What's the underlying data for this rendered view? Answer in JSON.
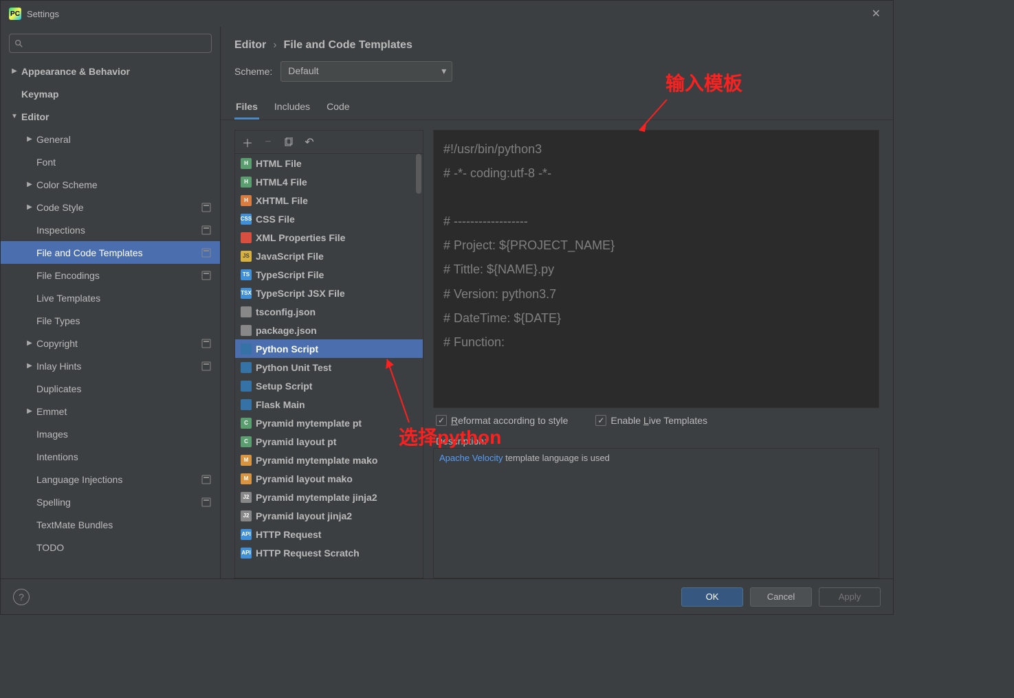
{
  "window": {
    "title": "Settings"
  },
  "sidebar": {
    "search_placeholder": "",
    "items": [
      {
        "label": "Appearance & Behavior",
        "expand": "right",
        "lv": 0
      },
      {
        "label": "Keymap",
        "lv": 0
      },
      {
        "label": "Editor",
        "expand": "down",
        "lv": 0
      },
      {
        "label": "General",
        "expand": "right",
        "lv": 1,
        "sub": true
      },
      {
        "label": "Font",
        "lv": 1,
        "sub": true
      },
      {
        "label": "Color Scheme",
        "expand": "right",
        "lv": 1,
        "sub": true
      },
      {
        "label": "Code Style",
        "expand": "right",
        "lv": 1,
        "sub": true,
        "badge": true
      },
      {
        "label": "Inspections",
        "lv": 1,
        "sub": true,
        "badge": true
      },
      {
        "label": "File and Code Templates",
        "lv": 1,
        "sub": true,
        "badge": true,
        "selected": true
      },
      {
        "label": "File Encodings",
        "lv": 1,
        "sub": true,
        "badge": true
      },
      {
        "label": "Live Templates",
        "lv": 1,
        "sub": true
      },
      {
        "label": "File Types",
        "lv": 1,
        "sub": true
      },
      {
        "label": "Copyright",
        "expand": "right",
        "lv": 1,
        "sub": true,
        "badge": true
      },
      {
        "label": "Inlay Hints",
        "expand": "right",
        "lv": 1,
        "sub": true,
        "badge": true
      },
      {
        "label": "Duplicates",
        "lv": 1,
        "sub": true
      },
      {
        "label": "Emmet",
        "expand": "right",
        "lv": 1,
        "sub": true
      },
      {
        "label": "Images",
        "lv": 1,
        "sub": true
      },
      {
        "label": "Intentions",
        "lv": 1,
        "sub": true
      },
      {
        "label": "Language Injections",
        "lv": 1,
        "sub": true,
        "badge": true
      },
      {
        "label": "Spelling",
        "lv": 1,
        "sub": true,
        "badge": true
      },
      {
        "label": "TextMate Bundles",
        "lv": 1,
        "sub": true
      },
      {
        "label": "TODO",
        "lv": 1,
        "sub": true
      }
    ]
  },
  "breadcrumb": {
    "l1": "Editor",
    "sep": "›",
    "l2": "File and Code Templates"
  },
  "scheme": {
    "label": "Scheme:",
    "value": "Default"
  },
  "tabs": [
    {
      "label": "Files",
      "active": true
    },
    {
      "label": "Includes"
    },
    {
      "label": "Code"
    }
  ],
  "templates": [
    {
      "label": "HTML File",
      "icon": "ic-html",
      "t": "H"
    },
    {
      "label": "HTML4 File",
      "icon": "ic-html4",
      "t": "H"
    },
    {
      "label": "XHTML File",
      "icon": "ic-xhtml",
      "t": "H"
    },
    {
      "label": "CSS File",
      "icon": "ic-css",
      "t": "CSS"
    },
    {
      "label": "XML Properties File",
      "icon": "ic-xml",
      "t": ""
    },
    {
      "label": "JavaScript File",
      "icon": "ic-js",
      "t": "JS"
    },
    {
      "label": "TypeScript File",
      "icon": "ic-ts",
      "t": "TS"
    },
    {
      "label": "TypeScript JSX File",
      "icon": "ic-tsx",
      "t": "TSX"
    },
    {
      "label": "tsconfig.json",
      "icon": "ic-json",
      "t": ""
    },
    {
      "label": "package.json",
      "icon": "ic-json",
      "t": ""
    },
    {
      "label": "Python Script",
      "icon": "ic-py",
      "t": "",
      "selected": true
    },
    {
      "label": "Python Unit Test",
      "icon": "ic-py",
      "t": ""
    },
    {
      "label": "Setup Script",
      "icon": "ic-py",
      "t": ""
    },
    {
      "label": "Flask Main",
      "icon": "ic-py",
      "t": ""
    },
    {
      "label": "Pyramid mytemplate pt",
      "icon": "ic-c",
      "t": "C"
    },
    {
      "label": "Pyramid layout pt",
      "icon": "ic-c",
      "t": "C"
    },
    {
      "label": "Pyramid mytemplate mako",
      "icon": "ic-m",
      "t": "M"
    },
    {
      "label": "Pyramid layout mako",
      "icon": "ic-m",
      "t": "M"
    },
    {
      "label": "Pyramid mytemplate jinja2",
      "icon": "ic-j2",
      "t": "J2"
    },
    {
      "label": "Pyramid layout jinja2",
      "icon": "ic-j2",
      "t": "J2"
    },
    {
      "label": "HTTP Request",
      "icon": "ic-api",
      "t": "API"
    },
    {
      "label": "HTTP Request Scratch",
      "icon": "ic-api",
      "t": "API"
    }
  ],
  "code": {
    "l1": "#!/usr/bin/python3",
    "l2": "# -*- coding:utf-8 -*-",
    "l3": "",
    "l4": "# ------------------",
    "l5": "# Project: ${PROJECT_NAME}",
    "l6": "# Tittle: ${NAME}.py",
    "l7": "# Version: python3.7",
    "l8": "# DateTime: ${DATE}",
    "l9": "# Function:"
  },
  "options": {
    "reformat_r": "R",
    "reformat_rest": "eformat according to style",
    "enable_pre": "Enable ",
    "enable_l": "L",
    "enable_rest": "ive Templates"
  },
  "description": {
    "label": "Description:",
    "link": "Apache Velocity",
    "text": " template language is used"
  },
  "buttons": {
    "ok": "OK",
    "cancel": "Cancel",
    "apply": "Apply"
  },
  "annotations": {
    "top": "输入模板",
    "bottom": "选择python"
  }
}
